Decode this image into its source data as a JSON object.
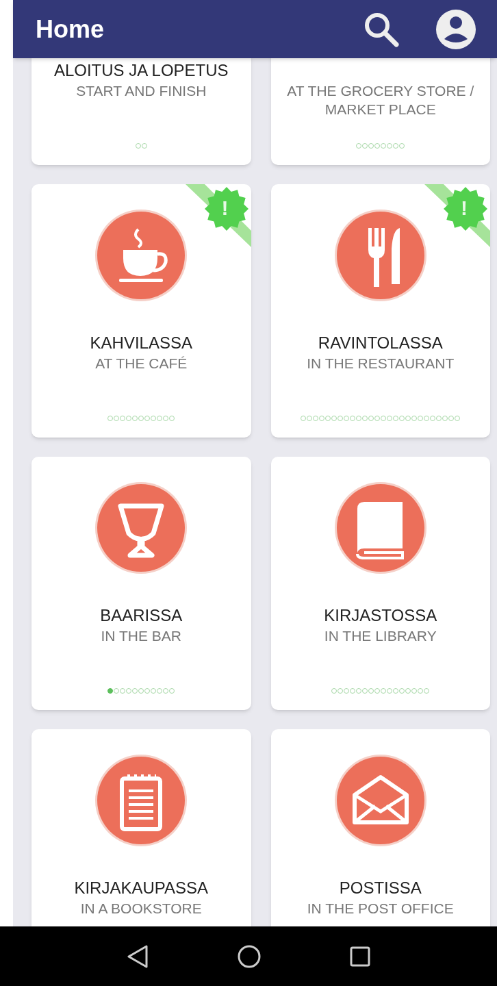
{
  "app_bar": {
    "title": "Home"
  },
  "cards": [
    {
      "title": "ALOITUS JA LOPETUS",
      "subtitle": "START AND FINISH",
      "steps": [
        {
          "done": false
        },
        {
          "done": false
        }
      ]
    },
    {
      "subtitle": "AT THE GROCERY STORE / MARKET PLACE",
      "steps": [
        {
          "done": false
        },
        {
          "done": false
        },
        {
          "done": false
        },
        {
          "done": false
        },
        {
          "done": false
        },
        {
          "done": false
        },
        {
          "done": false
        },
        {
          "done": false
        }
      ]
    },
    {
      "title": "KAHVILASSA",
      "subtitle": "AT THE CAFÉ",
      "badge": "!",
      "steps": [
        {
          "done": false
        },
        {
          "done": false
        },
        {
          "done": false
        },
        {
          "done": false
        },
        {
          "done": false
        },
        {
          "done": false
        },
        {
          "done": false
        },
        {
          "done": false
        },
        {
          "done": false
        },
        {
          "done": false
        },
        {
          "done": false
        }
      ]
    },
    {
      "title": "RAVINTOLASSA",
      "subtitle": "IN THE RESTAURANT",
      "badge": "!",
      "steps": [
        {
          "done": false
        },
        {
          "done": false
        },
        {
          "done": false
        },
        {
          "done": false
        },
        {
          "done": false
        },
        {
          "done": false
        },
        {
          "done": false
        },
        {
          "done": false
        },
        {
          "done": false
        },
        {
          "done": false
        },
        {
          "done": false
        },
        {
          "done": false
        },
        {
          "done": false
        },
        {
          "done": false
        },
        {
          "done": false
        },
        {
          "done": false
        },
        {
          "done": false
        },
        {
          "done": false
        },
        {
          "done": false
        },
        {
          "done": false
        },
        {
          "done": false
        },
        {
          "done": false
        },
        {
          "done": false
        },
        {
          "done": false
        },
        {
          "done": false
        },
        {
          "done": false
        }
      ]
    },
    {
      "title": "BAARISSA",
      "subtitle": "IN THE BAR",
      "steps": [
        {
          "done": true
        },
        {
          "done": false
        },
        {
          "done": false
        },
        {
          "done": false
        },
        {
          "done": false
        },
        {
          "done": false
        },
        {
          "done": false
        },
        {
          "done": false
        },
        {
          "done": false
        },
        {
          "done": false
        },
        {
          "done": false
        }
      ]
    },
    {
      "title": "KIRJASTOSSA",
      "subtitle": "IN THE LIBRARY",
      "steps": [
        {
          "done": false
        },
        {
          "done": false
        },
        {
          "done": false
        },
        {
          "done": false
        },
        {
          "done": false
        },
        {
          "done": false
        },
        {
          "done": false
        },
        {
          "done": false
        },
        {
          "done": false
        },
        {
          "done": false
        },
        {
          "done": false
        },
        {
          "done": false
        },
        {
          "done": false
        },
        {
          "done": false
        },
        {
          "done": false
        },
        {
          "done": false
        }
      ]
    },
    {
      "title": "KIRJAKAUPASSA",
      "subtitle": "IN A BOOKSTORE"
    },
    {
      "title": "POSTISSA",
      "subtitle": "IN THE POST OFFICE"
    }
  ]
}
